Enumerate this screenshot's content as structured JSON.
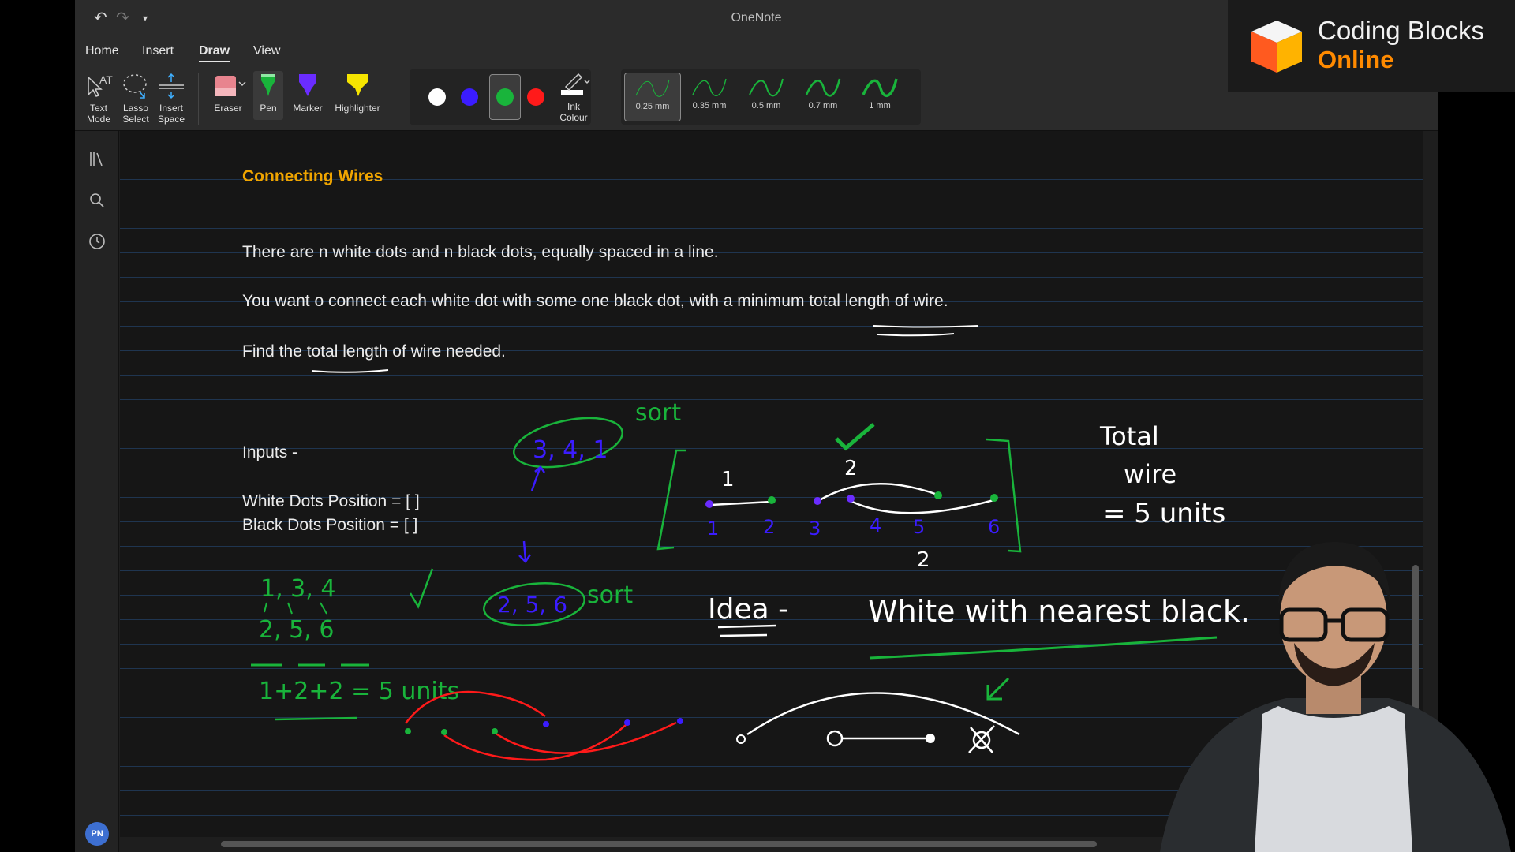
{
  "window": {
    "title": "OneNote"
  },
  "tabs": [
    "Home",
    "Insert",
    "Draw",
    "View"
  ],
  "ribbon": {
    "tools": [
      {
        "label1": "Text",
        "label2": "Mode"
      },
      {
        "label1": "Lasso",
        "label2": "Select"
      },
      {
        "label1": "Insert",
        "label2": "Space"
      }
    ],
    "eraser": "Eraser",
    "pen": "Pen",
    "marker": "Marker",
    "highlighter": "Highlighter",
    "ink_colour": {
      "label1": "Ink",
      "label2": "Colour"
    },
    "colors": [
      "#ffffff",
      "#3b1cff",
      "#19b43b",
      "#ff1a1a"
    ],
    "selected_color": "#19b43b",
    "widths": [
      "0.25 mm",
      "0.35 mm",
      "0.5 mm",
      "0.7 mm",
      "1 mm"
    ],
    "selected_width": "0.25 mm"
  },
  "note": {
    "title": "Connecting Wires",
    "line1": "There are n white dots and n black dots, equally spaced in a line.",
    "line2": "You  want o connect each white dot with some one black dot, with a minimum total length of wire.",
    "line3": "Find the total length of wire needed.",
    "inputs": "Inputs -",
    "white_dots": "White Dots Position =  [ ]",
    "black_dots": "Black Dots Position = [ ]"
  },
  "handwriting": {
    "sort1": "sort",
    "sort2": "sort",
    "white_values": "3, 4, 1",
    "black_values": "2, 5, 6",
    "sorted_white": "1, 3, 4",
    "sorted_black": "2, 5, 6",
    "sum": "1+2+2 = 5 units",
    "bracket_gaps": [
      "1",
      "2",
      "2"
    ],
    "positions": [
      "1",
      "2",
      "3",
      "4",
      "5",
      "6"
    ],
    "total_wire": [
      "Total",
      "wire",
      "= 5 units"
    ],
    "idea_label": "Idea -",
    "idea_text": "White with nearest black."
  },
  "brand": {
    "line1": "Coding Blocks",
    "line2": "Online"
  },
  "user_initials": "PN"
}
